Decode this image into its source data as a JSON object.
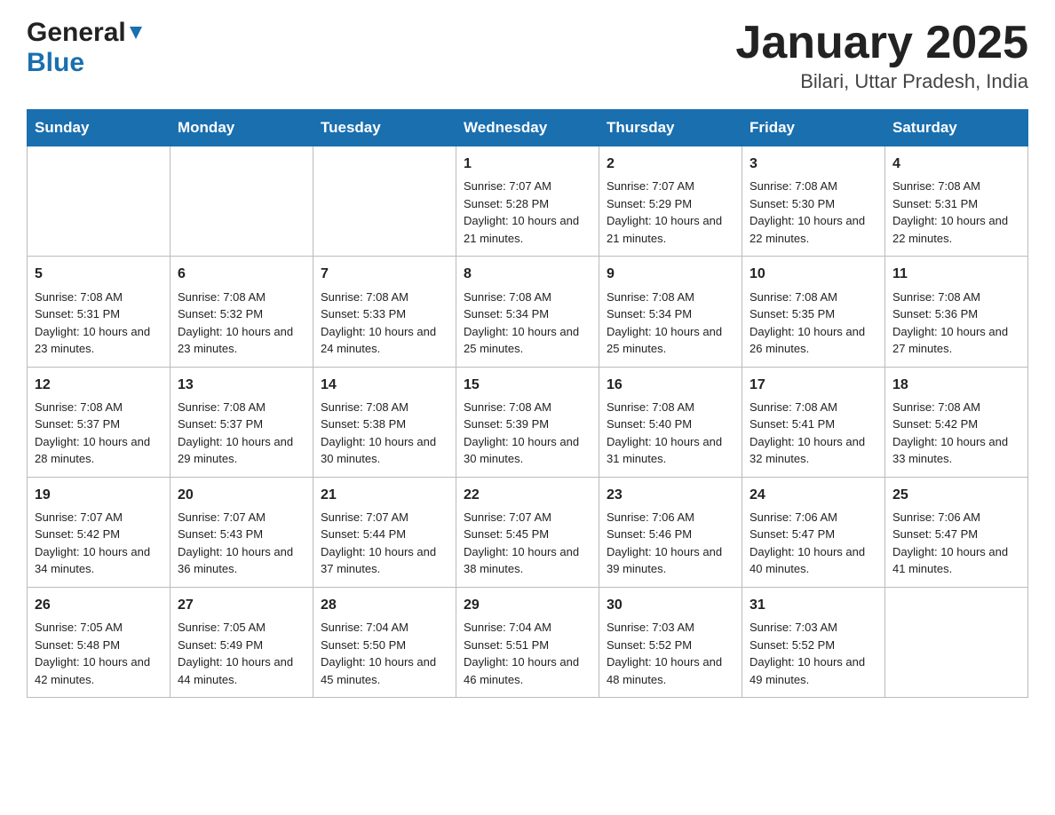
{
  "header": {
    "logo": {
      "general": "General",
      "blue": "Blue",
      "arrow_color": "#1a6faf"
    },
    "title": "January 2025",
    "location": "Bilari, Uttar Pradesh, India"
  },
  "calendar": {
    "days_of_week": [
      "Sunday",
      "Monday",
      "Tuesday",
      "Wednesday",
      "Thursday",
      "Friday",
      "Saturday"
    ],
    "header_color": "#1a6faf",
    "weeks": [
      [
        {
          "day": "",
          "info": ""
        },
        {
          "day": "",
          "info": ""
        },
        {
          "day": "",
          "info": ""
        },
        {
          "day": "1",
          "info": "Sunrise: 7:07 AM\nSunset: 5:28 PM\nDaylight: 10 hours and 21 minutes."
        },
        {
          "day": "2",
          "info": "Sunrise: 7:07 AM\nSunset: 5:29 PM\nDaylight: 10 hours and 21 minutes."
        },
        {
          "day": "3",
          "info": "Sunrise: 7:08 AM\nSunset: 5:30 PM\nDaylight: 10 hours and 22 minutes."
        },
        {
          "day": "4",
          "info": "Sunrise: 7:08 AM\nSunset: 5:31 PM\nDaylight: 10 hours and 22 minutes."
        }
      ],
      [
        {
          "day": "5",
          "info": "Sunrise: 7:08 AM\nSunset: 5:31 PM\nDaylight: 10 hours and 23 minutes."
        },
        {
          "day": "6",
          "info": "Sunrise: 7:08 AM\nSunset: 5:32 PM\nDaylight: 10 hours and 23 minutes."
        },
        {
          "day": "7",
          "info": "Sunrise: 7:08 AM\nSunset: 5:33 PM\nDaylight: 10 hours and 24 minutes."
        },
        {
          "day": "8",
          "info": "Sunrise: 7:08 AM\nSunset: 5:34 PM\nDaylight: 10 hours and 25 minutes."
        },
        {
          "day": "9",
          "info": "Sunrise: 7:08 AM\nSunset: 5:34 PM\nDaylight: 10 hours and 25 minutes."
        },
        {
          "day": "10",
          "info": "Sunrise: 7:08 AM\nSunset: 5:35 PM\nDaylight: 10 hours and 26 minutes."
        },
        {
          "day": "11",
          "info": "Sunrise: 7:08 AM\nSunset: 5:36 PM\nDaylight: 10 hours and 27 minutes."
        }
      ],
      [
        {
          "day": "12",
          "info": "Sunrise: 7:08 AM\nSunset: 5:37 PM\nDaylight: 10 hours and 28 minutes."
        },
        {
          "day": "13",
          "info": "Sunrise: 7:08 AM\nSunset: 5:37 PM\nDaylight: 10 hours and 29 minutes."
        },
        {
          "day": "14",
          "info": "Sunrise: 7:08 AM\nSunset: 5:38 PM\nDaylight: 10 hours and 30 minutes."
        },
        {
          "day": "15",
          "info": "Sunrise: 7:08 AM\nSunset: 5:39 PM\nDaylight: 10 hours and 30 minutes."
        },
        {
          "day": "16",
          "info": "Sunrise: 7:08 AM\nSunset: 5:40 PM\nDaylight: 10 hours and 31 minutes."
        },
        {
          "day": "17",
          "info": "Sunrise: 7:08 AM\nSunset: 5:41 PM\nDaylight: 10 hours and 32 minutes."
        },
        {
          "day": "18",
          "info": "Sunrise: 7:08 AM\nSunset: 5:42 PM\nDaylight: 10 hours and 33 minutes."
        }
      ],
      [
        {
          "day": "19",
          "info": "Sunrise: 7:07 AM\nSunset: 5:42 PM\nDaylight: 10 hours and 34 minutes."
        },
        {
          "day": "20",
          "info": "Sunrise: 7:07 AM\nSunset: 5:43 PM\nDaylight: 10 hours and 36 minutes."
        },
        {
          "day": "21",
          "info": "Sunrise: 7:07 AM\nSunset: 5:44 PM\nDaylight: 10 hours and 37 minutes."
        },
        {
          "day": "22",
          "info": "Sunrise: 7:07 AM\nSunset: 5:45 PM\nDaylight: 10 hours and 38 minutes."
        },
        {
          "day": "23",
          "info": "Sunrise: 7:06 AM\nSunset: 5:46 PM\nDaylight: 10 hours and 39 minutes."
        },
        {
          "day": "24",
          "info": "Sunrise: 7:06 AM\nSunset: 5:47 PM\nDaylight: 10 hours and 40 minutes."
        },
        {
          "day": "25",
          "info": "Sunrise: 7:06 AM\nSunset: 5:47 PM\nDaylight: 10 hours and 41 minutes."
        }
      ],
      [
        {
          "day": "26",
          "info": "Sunrise: 7:05 AM\nSunset: 5:48 PM\nDaylight: 10 hours and 42 minutes."
        },
        {
          "day": "27",
          "info": "Sunrise: 7:05 AM\nSunset: 5:49 PM\nDaylight: 10 hours and 44 minutes."
        },
        {
          "day": "28",
          "info": "Sunrise: 7:04 AM\nSunset: 5:50 PM\nDaylight: 10 hours and 45 minutes."
        },
        {
          "day": "29",
          "info": "Sunrise: 7:04 AM\nSunset: 5:51 PM\nDaylight: 10 hours and 46 minutes."
        },
        {
          "day": "30",
          "info": "Sunrise: 7:03 AM\nSunset: 5:52 PM\nDaylight: 10 hours and 48 minutes."
        },
        {
          "day": "31",
          "info": "Sunrise: 7:03 AM\nSunset: 5:52 PM\nDaylight: 10 hours and 49 minutes."
        },
        {
          "day": "",
          "info": ""
        }
      ]
    ]
  }
}
